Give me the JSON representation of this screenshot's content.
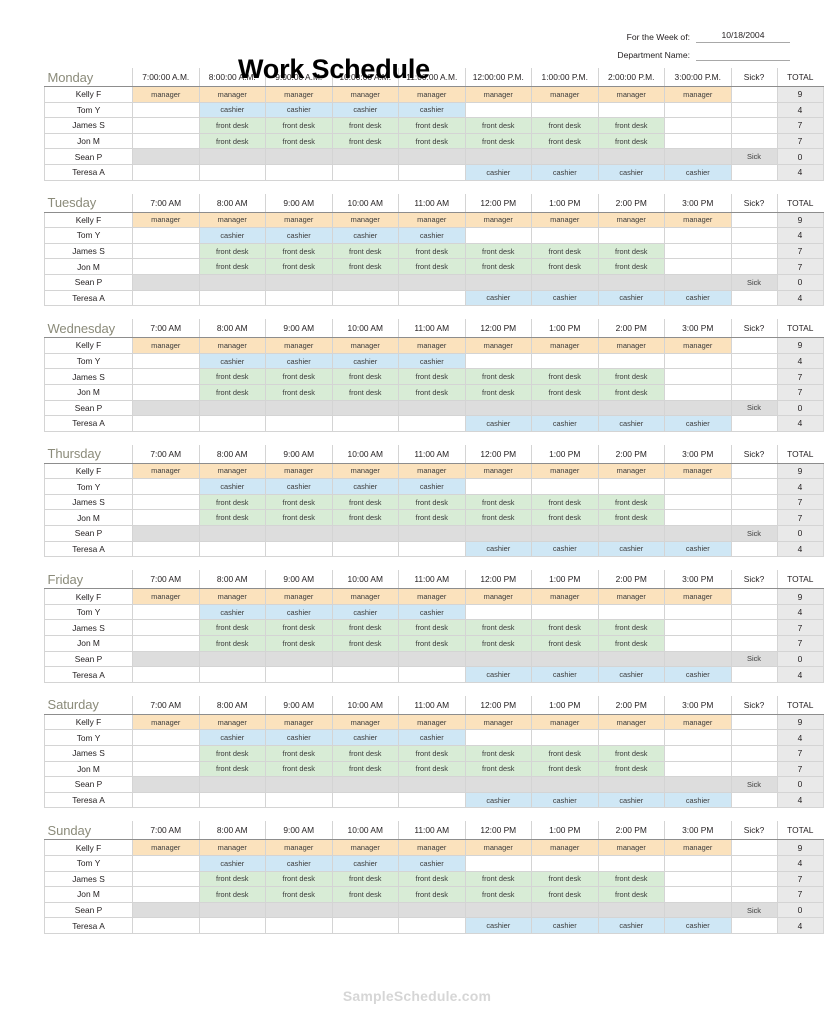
{
  "document": {
    "title": "Work Schedule",
    "footer": "SampleSchedule.com"
  },
  "meta": {
    "week_label": "For the Week of:",
    "week_value": "10/18/2004",
    "department_label": "Department Name:",
    "department_value": ""
  },
  "columns": {
    "sick_header": "Sick?",
    "total_header": "TOTAL",
    "times_long": [
      "7:00:00 A.M.",
      "8:00:00 A.M.",
      "9:00:00 A.M.",
      "10:00:00 A.M.",
      "11:00:00 A.M.",
      "12:00:00 P.M.",
      "1:00:00 P.M.",
      "2:00:00 P.M.",
      "3:00:00 P.M."
    ],
    "times_short": [
      "7:00 AM",
      "8:00 AM",
      "9:00 AM",
      "10:00 AM",
      "11:00 AM",
      "12:00 PM",
      "1:00 PM",
      "2:00 PM",
      "3:00 PM"
    ]
  },
  "shift_labels": {
    "manager": "manager",
    "cashier": "cashier",
    "frontdesk": "front desk",
    "sick": "Sick",
    "empty": ""
  },
  "colors": {
    "manager": "#fbe2bd",
    "cashier": "#cfe7f5",
    "frontdesk": "#d8ecd6",
    "sick_row": "#dddddd",
    "total_column": "#e9e9e9",
    "day_name": "#8b8b7a",
    "footer": "#d6d6d6"
  },
  "employees": [
    {
      "name": "Kelly F",
      "role": "manager",
      "slots": [
        "manager",
        "manager",
        "manager",
        "manager",
        "manager",
        "manager",
        "manager",
        "manager",
        "manager"
      ],
      "sick": "",
      "total": "9"
    },
    {
      "name": "Tom Y",
      "role": "cashier",
      "slots": [
        "",
        "cashier",
        "cashier",
        "cashier",
        "cashier",
        "",
        "",
        "",
        ""
      ],
      "sick": "",
      "total": "4"
    },
    {
      "name": "James S",
      "role": "frontdesk",
      "slots": [
        "",
        "frontdesk",
        "frontdesk",
        "frontdesk",
        "frontdesk",
        "frontdesk",
        "frontdesk",
        "frontdesk",
        ""
      ],
      "sick": "",
      "total": "7"
    },
    {
      "name": "Jon M",
      "role": "frontdesk",
      "slots": [
        "",
        "frontdesk",
        "frontdesk",
        "frontdesk",
        "frontdesk",
        "frontdesk",
        "frontdesk",
        "frontdesk",
        ""
      ],
      "sick": "",
      "total": "7"
    },
    {
      "name": "Sean P",
      "role": "sickrow",
      "slots": [
        "sickrow",
        "sickrow",
        "sickrow",
        "sickrow",
        "sickrow",
        "sickrow",
        "sickrow",
        "sickrow",
        "sickrow"
      ],
      "sick": "Sick",
      "total": "0"
    },
    {
      "name": "Teresa A",
      "role": "cashier",
      "slots": [
        "",
        "",
        "",
        "",
        "",
        "cashier",
        "cashier",
        "cashier",
        "cashier"
      ],
      "sick": "",
      "total": "4"
    }
  ],
  "days": [
    {
      "name": "Monday",
      "time_format": "long"
    },
    {
      "name": "Tuesday",
      "time_format": "short"
    },
    {
      "name": "Wednesday",
      "time_format": "short"
    },
    {
      "name": "Thursday",
      "time_format": "short"
    },
    {
      "name": "Friday",
      "time_format": "short"
    },
    {
      "name": "Saturday",
      "time_format": "short"
    },
    {
      "name": "Sunday",
      "time_format": "short"
    }
  ]
}
